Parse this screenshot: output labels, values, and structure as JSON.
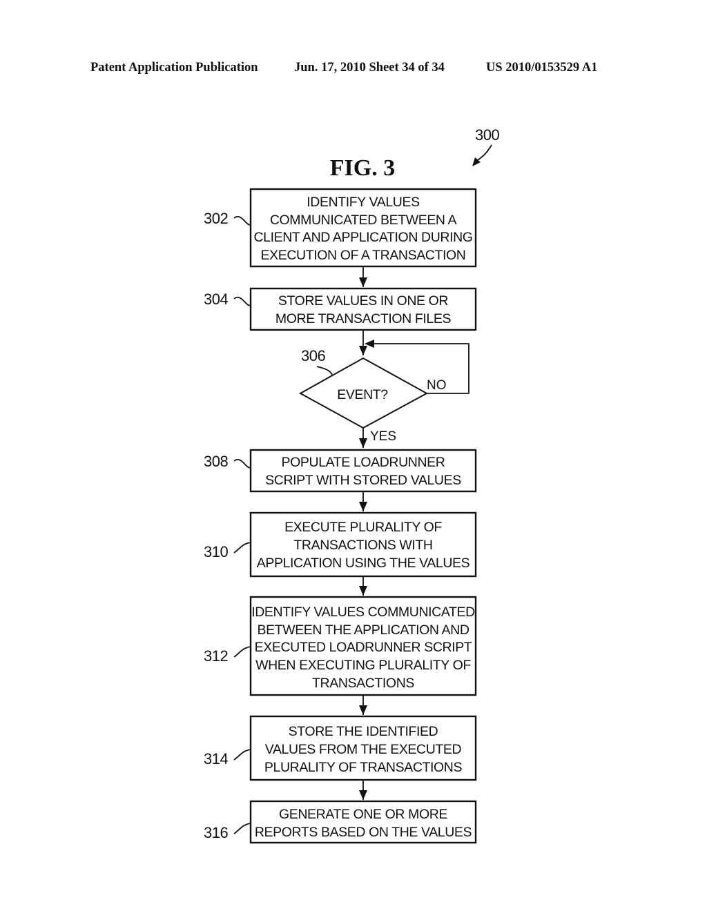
{
  "header": {
    "publication": "Patent Application Publication",
    "date_sheet": "Jun. 17, 2010  Sheet 34 of 34",
    "number": "US 2010/0153529 A1"
  },
  "figure": {
    "title": "FIG. 3",
    "ref": "300"
  },
  "steps": [
    {
      "ref": "302",
      "lines": [
        "IDENTIFY VALUES",
        "COMMUNICATED BETWEEN A",
        "CLIENT AND APPLICATION DURING",
        "EXECUTION OF A TRANSACTION"
      ]
    },
    {
      "ref": "304",
      "lines": [
        "STORE VALUES IN ONE OR",
        "MORE TRANSACTION FILES"
      ]
    },
    {
      "ref": "306",
      "decision": "EVENT?",
      "no_label": "NO",
      "yes_label": "YES"
    },
    {
      "ref": "308",
      "lines": [
        "POPULATE LOADRUNNER",
        "SCRIPT WITH STORED VALUES"
      ]
    },
    {
      "ref": "310",
      "lines": [
        "EXECUTE PLURALITY OF",
        "TRANSACTIONS WITH",
        "APPLICATION USING THE VALUES"
      ]
    },
    {
      "ref": "312",
      "lines": [
        "IDENTIFY VALUES COMMUNICATED",
        "BETWEEN THE APPLICATION AND",
        "EXECUTED LOADRUNNER SCRIPT",
        "WHEN EXECUTING PLURALITY OF",
        "TRANSACTIONS"
      ]
    },
    {
      "ref": "314",
      "lines": [
        "STORE THE IDENTIFIED",
        "VALUES FROM THE EXECUTED",
        "PLURALITY OF TRANSACTIONS"
      ]
    },
    {
      "ref": "316",
      "lines": [
        "GENERATE ONE OR MORE",
        "REPORTS BASED ON THE VALUES"
      ]
    }
  ]
}
